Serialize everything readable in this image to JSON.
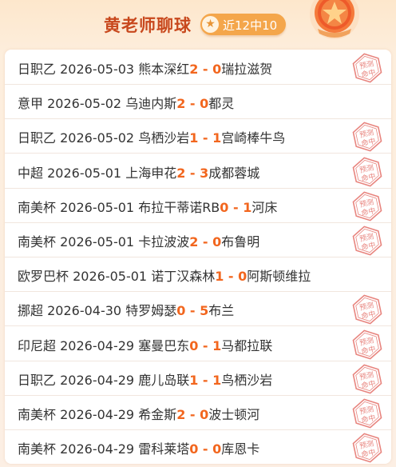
{
  "header": {
    "title": "黄老师聊球",
    "badge_text": "近12中10"
  },
  "stamp_text": [
    "预测",
    "命中"
  ],
  "colors": {
    "accent": "#f2661e",
    "title": "#c8481d",
    "badge": "#f4a64b",
    "stamp": "#e8857f"
  },
  "matches": [
    {
      "league": "日职乙",
      "date": "2026-05-03",
      "home": "熊本深红",
      "home_score": "2",
      "sep": " - ",
      "away_score": "0",
      "away": "瑞拉滋贺",
      "hit": true
    },
    {
      "league": "意甲",
      "date": "2026-05-02",
      "home": "乌迪内斯",
      "home_score": "2",
      "sep": " - ",
      "away_score": "0",
      "away": "都灵",
      "hit": false
    },
    {
      "league": "日职乙",
      "date": "2026-05-02",
      "home": "鸟栖沙岩",
      "home_score": "1",
      "sep": " - ",
      "away_score": "1",
      "away": "宫崎棒牛鸟",
      "hit": true
    },
    {
      "league": "中超",
      "date": "2026-05-01",
      "home": "上海申花",
      "home_score": "2",
      "sep": " - ",
      "away_score": "3",
      "away": "成都蓉城",
      "hit": true
    },
    {
      "league": "南美杯",
      "date": "2026-05-01",
      "home": "布拉干蒂诺RB",
      "home_score": "0",
      "sep": " - ",
      "away_score": "1",
      "away": "河床",
      "hit": true
    },
    {
      "league": "南美杯",
      "date": "2026-05-01",
      "home": "卡拉波波",
      "home_score": "2",
      "sep": " - ",
      "away_score": "0",
      "away": "布鲁明",
      "hit": true
    },
    {
      "league": "欧罗巴杯",
      "date": "2026-05-01",
      "home": "诺丁汉森林",
      "home_score": "1",
      "sep": " - ",
      "away_score": "0",
      "away": "阿斯顿维拉",
      "hit": false
    },
    {
      "league": "挪超",
      "date": "2026-04-30",
      "home": "特罗姆瑟",
      "home_score": "0",
      "sep": " - ",
      "away_score": "5",
      "away": "布兰",
      "hit": true
    },
    {
      "league": "印尼超",
      "date": "2026-04-29",
      "home": "塞曼巴东",
      "home_score": "0",
      "sep": " - ",
      "away_score": "1",
      "away": "马都拉联",
      "hit": true
    },
    {
      "league": "日职乙",
      "date": "2026-04-29",
      "home": "鹿儿岛联",
      "home_score": "1",
      "sep": " - ",
      "away_score": "1",
      "away": "鸟栖沙岩",
      "hit": true
    },
    {
      "league": "南美杯",
      "date": "2026-04-29",
      "home": "希金斯",
      "home_score": "2",
      "sep": " - ",
      "away_score": "0",
      "away": "波士顿河",
      "hit": true
    },
    {
      "league": "南美杯",
      "date": "2026-04-29",
      "home": "雷科莱塔",
      "home_score": "0",
      "sep": " - ",
      "away_score": "0",
      "away": "库恩卡",
      "hit": true
    }
  ]
}
